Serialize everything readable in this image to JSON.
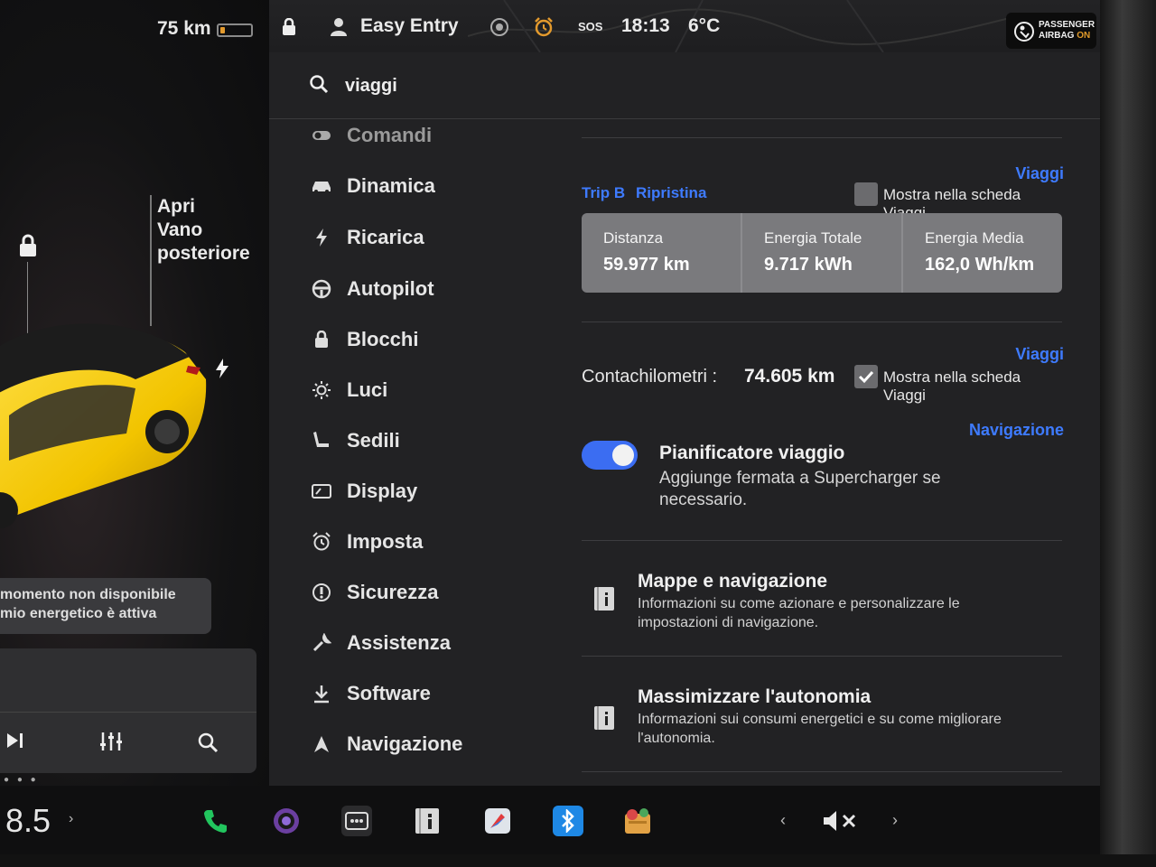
{
  "status": {
    "range": "75 km",
    "profile": "Easy Entry",
    "sos": "SOS",
    "time": "18:13",
    "temperature": "6°C",
    "airbag_line1": "PASSENGER",
    "airbag_line2_prefix": "AIRBAG",
    "airbag_line2_state": "ON"
  },
  "car": {
    "trunk_label_1": "Apri",
    "trunk_label_2": "Vano",
    "trunk_label_3": "posteriore",
    "notice_line1": "momento non disponibile",
    "notice_line2": "mio energetico è attiva"
  },
  "search": {
    "value": "viaggi"
  },
  "menu": {
    "items": [
      {
        "label": "Comandi",
        "icon": "toggle-icon"
      },
      {
        "label": "Dinamica",
        "icon": "car-icon"
      },
      {
        "label": "Ricarica",
        "icon": "bolt-icon"
      },
      {
        "label": "Autopilot",
        "icon": "steering-wheel-icon"
      },
      {
        "label": "Blocchi",
        "icon": "lock-icon"
      },
      {
        "label": "Luci",
        "icon": "sun-icon"
      },
      {
        "label": "Sedili",
        "icon": "seat-icon"
      },
      {
        "label": "Display",
        "icon": "display-icon"
      },
      {
        "label": "Imposta",
        "icon": "alarm-icon"
      },
      {
        "label": "Sicurezza",
        "icon": "shield-icon"
      },
      {
        "label": "Assistenza",
        "icon": "wrench-icon"
      },
      {
        "label": "Software",
        "icon": "download-icon"
      },
      {
        "label": "Navigazione",
        "icon": "navigation-icon"
      }
    ]
  },
  "trip": {
    "section_link": "Viaggi",
    "trip_name": "Trip B",
    "reset_label": "Ripristina",
    "show_label": "Mostra nella scheda Viaggi",
    "show_checked": false,
    "stats": [
      {
        "label": "Distanza",
        "value": "59.977 km"
      },
      {
        "label": "Energia Totale",
        "value": "9.717 kWh"
      },
      {
        "label": "Energia Media",
        "value": "162,0 Wh/km"
      }
    ]
  },
  "odometer": {
    "section_link": "Viaggi",
    "label": "Contachilometri :",
    "value": "74.605 km",
    "show_label": "Mostra nella scheda Viaggi",
    "show_checked": true
  },
  "planner": {
    "section_link": "Navigazione",
    "title": "Pianificatore viaggio",
    "description": "Aggiunge fermata a Supercharger se necessario.",
    "enabled": true
  },
  "articles": [
    {
      "title": "Mappe e navigazione",
      "description": "Informazioni su come azionare e personalizzare le impostazioni di navigazione."
    },
    {
      "title": "Massimizzare l'autonomia",
      "description": "Informazioni sui consumi energetici e su come migliorare l'autonomia."
    }
  ],
  "dock": {
    "speed_value": "8.5"
  },
  "colors": {
    "accent": "#3e7bff",
    "toggle_on": "#3b6df2",
    "battery": "#e39a2d",
    "car_yellow": "#f2c400",
    "phone_green": "#22c55e",
    "bluetooth_blue": "#1e88e5"
  }
}
